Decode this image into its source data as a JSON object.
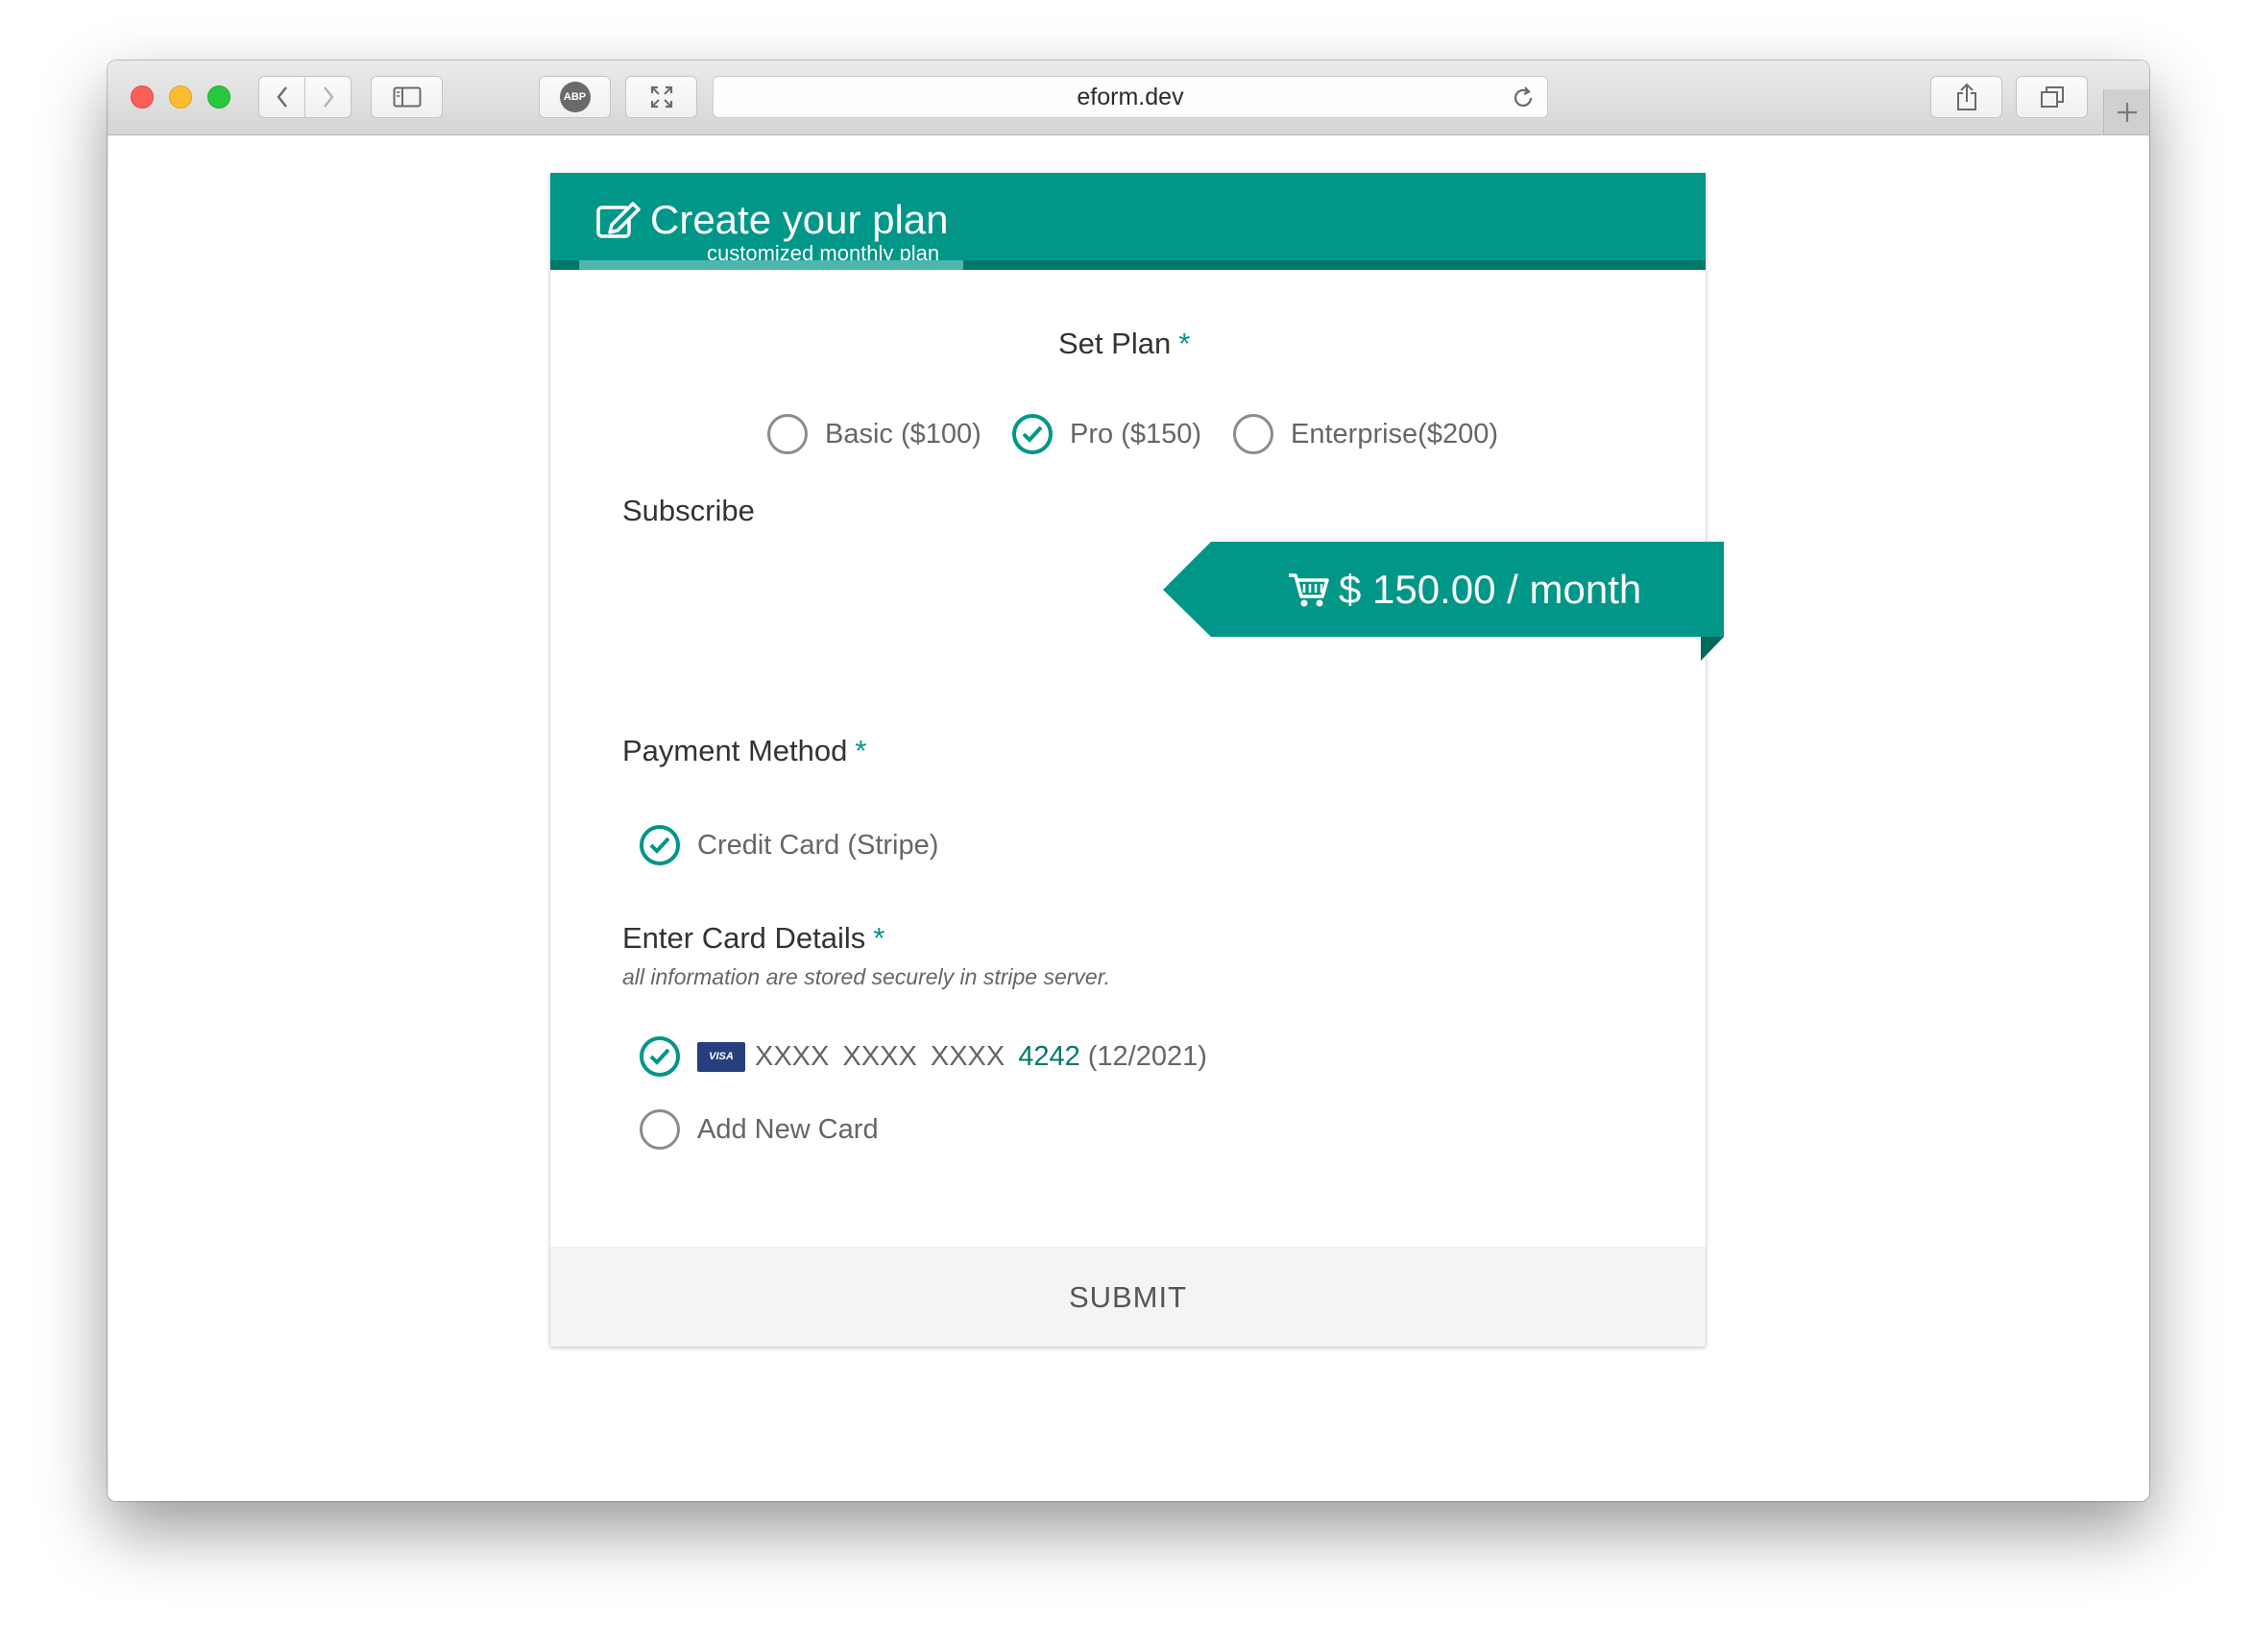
{
  "browser": {
    "url": "eform.dev",
    "adblock_label": "ABP"
  },
  "header": {
    "title": "Create your plan",
    "subtitle": "customized monthly plan"
  },
  "plan": {
    "label": "Set Plan",
    "required_mark": "*",
    "options": [
      {
        "label": "Basic ($100)",
        "checked": false
      },
      {
        "label": "Pro ($150)",
        "checked": true
      },
      {
        "label": "Enterprise($200)",
        "checked": false
      }
    ]
  },
  "subscribe": {
    "label": "Subscribe",
    "price": "$ 150.00 / month"
  },
  "payment": {
    "label": "Payment Method",
    "required_mark": "*",
    "option": "Credit Card (Stripe)"
  },
  "card_details": {
    "label": "Enter Card Details",
    "required_mark": "*",
    "note": "all information are stored securely in stripe server.",
    "saved_card": {
      "brand": "VISA",
      "masked": "XXXX XXXX XXXX",
      "last4": "4242",
      "expiry": "(12/2021)"
    },
    "add_new": "Add New Card"
  },
  "submit_label": "SUBMIT",
  "colors": {
    "accent": "#009688",
    "accent_dark": "#00796b"
  }
}
